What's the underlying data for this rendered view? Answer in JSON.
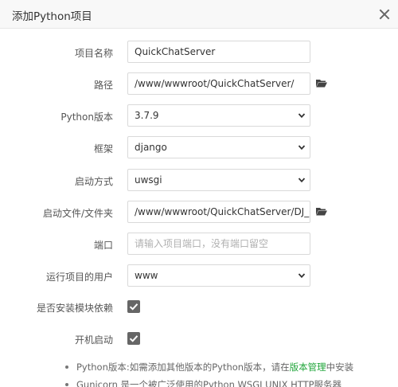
{
  "dialog": {
    "title": "添加Python项目"
  },
  "form": {
    "project_name": {
      "label": "项目名称",
      "value": "QuickChatServer"
    },
    "path": {
      "label": "路径",
      "value": "/www/wwwroot/QuickChatServer/"
    },
    "python_version": {
      "label": "Python版本",
      "value": "3.7.9"
    },
    "framework": {
      "label": "框架",
      "value": "django"
    },
    "start_method": {
      "label": "启动方式",
      "value": "uwsgi"
    },
    "startup_file": {
      "label": "启动文件/文件夹",
      "value": "/www/wwwroot/QuickChatServer/DJ_QuickC"
    },
    "port": {
      "label": "端口",
      "placeholder": "请输入项目端口，没有端口留空"
    },
    "run_user": {
      "label": "运行项目的用户",
      "value": "www"
    },
    "install_deps": {
      "label": "是否安装模块依赖",
      "checked": true
    },
    "autostart": {
      "label": "开机启动",
      "checked": true
    }
  },
  "notes": {
    "note1_prefix": "Python版本:如需添加其他版本的Python版本，请在",
    "note1_link": "版本管理",
    "note1_suffix": "中安装",
    "note2": "Gunicorn 是一个被广泛使用的Python WSGI UNIX HTTP服务器"
  },
  "icons": {
    "folder": "folder-icon",
    "chevron": "chevron-down-icon",
    "check": "check-icon",
    "close": "close-icon"
  },
  "colors": {
    "link": "#20a53a",
    "checkbox": "#666666"
  }
}
